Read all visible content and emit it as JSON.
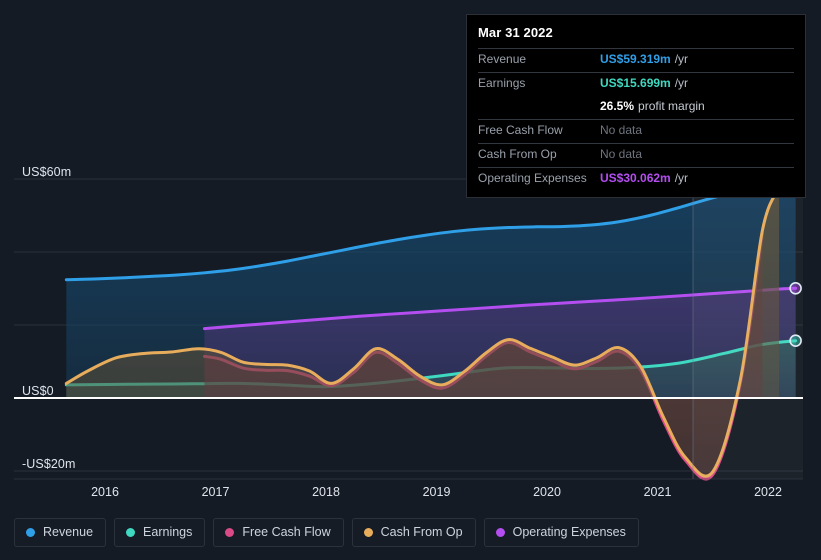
{
  "chart_data": {
    "type": "area",
    "title": "",
    "xlabel": "",
    "ylabel": "",
    "currency": "US$",
    "ylim": [
      -25,
      65
    ],
    "yticks": [
      60,
      0,
      -20
    ],
    "ytick_labels": [
      "US$60m",
      "US$0",
      "-US$20m"
    ],
    "gridlines": [
      60,
      40,
      20,
      0,
      -20
    ],
    "xlim": [
      2015.55,
      2022.35
    ],
    "xticks": [
      2016,
      2017,
      2018,
      2019,
      2020,
      2021,
      2022
    ],
    "xtick_labels": [
      "2016",
      "2017",
      "2018",
      "2019",
      "2020",
      "2021",
      "2022"
    ],
    "grid": true,
    "legend_position": "bottom",
    "zero_line": true,
    "series": [
      {
        "name": "Revenue",
        "color": "#2f9fe8",
        "fill": "#16476b",
        "end_value": 59.319,
        "x": [
          2015.65,
          2015.9,
          2016.15,
          2016.4,
          2016.65,
          2016.9,
          2017.15,
          2017.4,
          2017.65,
          2017.9,
          2018.15,
          2018.4,
          2018.65,
          2018.9,
          2019.15,
          2019.4,
          2019.65,
          2019.9,
          2020.15,
          2020.4,
          2020.65,
          2020.9,
          2021.15,
          2021.4,
          2021.65,
          2021.9,
          2022.08,
          2022.25
        ],
        "values": [
          32.4,
          32.6,
          32.9,
          33.3,
          33.7,
          34.3,
          35.1,
          36.2,
          37.5,
          39.0,
          40.5,
          42.0,
          43.4,
          44.6,
          45.6,
          46.3,
          46.7,
          46.9,
          47.0,
          47.4,
          48.3,
          49.8,
          51.8,
          54.0,
          56.0,
          57.6,
          58.7,
          59.319
        ]
      },
      {
        "name": "Earnings",
        "color": "#3fd8c0",
        "fill": "#2f5b5b",
        "end_value": 15.699,
        "x": [
          2015.65,
          2016.0,
          2016.4,
          2016.8,
          2017.2,
          2017.6,
          2018.0,
          2018.4,
          2018.8,
          2019.2,
          2019.6,
          2020.0,
          2020.4,
          2020.8,
          2021.2,
          2021.6,
          2021.9,
          2022.08,
          2022.25
        ],
        "values": [
          3.6,
          3.7,
          3.8,
          3.9,
          4.0,
          3.6,
          3.1,
          3.9,
          5.2,
          6.7,
          8.2,
          8.3,
          8.1,
          8.4,
          9.6,
          12.2,
          14.4,
          15.2,
          15.699
        ]
      },
      {
        "name": "Free Cash Flow",
        "color": "#d94a86",
        "fill": "#5a2340",
        "end_value": null,
        "start_x": 2016.9,
        "x": [
          2016.9,
          2017.05,
          2017.25,
          2017.45,
          2017.65,
          2017.85,
          2018.05,
          2018.25,
          2018.45,
          2018.65,
          2018.85,
          2019.05,
          2019.25,
          2019.45,
          2019.65,
          2019.85,
          2020.05,
          2020.25,
          2020.45,
          2020.65,
          2020.85,
          2021.05,
          2021.25,
          2021.5,
          2021.75,
          2021.95
        ],
        "values": [
          11.4,
          10.6,
          8.2,
          7.6,
          7.5,
          6.0,
          3.4,
          7.0,
          12.5,
          9.5,
          5.0,
          2.7,
          6.3,
          11.5,
          15.2,
          12.6,
          10.2,
          8.0,
          10.0,
          12.8,
          7.5,
          -6.0,
          -17.0,
          -21.0,
          4.0,
          45.0
        ]
      },
      {
        "name": "Cash From Op",
        "color": "#e8ad5c",
        "fill": "#5e5038",
        "end_value": null,
        "start_x": 2015.65,
        "x": [
          2015.65,
          2015.85,
          2016.1,
          2016.35,
          2016.6,
          2016.85,
          2017.05,
          2017.25,
          2017.45,
          2017.65,
          2017.85,
          2018.05,
          2018.25,
          2018.45,
          2018.65,
          2018.85,
          2019.05,
          2019.25,
          2019.45,
          2019.65,
          2019.85,
          2020.05,
          2020.25,
          2020.45,
          2020.65,
          2020.85,
          2021.05,
          2021.25,
          2021.5,
          2021.75,
          2021.95,
          2022.1
        ],
        "values": [
          4.0,
          7.5,
          11.0,
          12.2,
          12.6,
          13.5,
          12.5,
          9.8,
          9.2,
          9.0,
          7.4,
          4.0,
          8.0,
          13.5,
          10.6,
          6.0,
          3.6,
          7.2,
          12.4,
          16.0,
          13.6,
          11.2,
          9.0,
          11.0,
          13.8,
          8.5,
          -5.0,
          -16.2,
          -20.2,
          5.0,
          46.0,
          57.5
        ]
      },
      {
        "name": "Operating Expenses",
        "color": "#b44ef0",
        "fill": "#473570",
        "end_value": 30.062,
        "start_x": 2016.9,
        "x": [
          2016.9,
          2017.3,
          2017.8,
          2018.3,
          2018.8,
          2019.3,
          2019.8,
          2020.3,
          2020.8,
          2021.3,
          2021.8,
          2022.08,
          2022.25
        ],
        "values": [
          19.0,
          20.0,
          21.2,
          22.4,
          23.4,
          24.4,
          25.4,
          26.3,
          27.2,
          28.2,
          29.2,
          29.8,
          30.062
        ]
      }
    ]
  },
  "tooltip": {
    "title": "Mar 31 2022",
    "rows": [
      {
        "label": "Revenue",
        "value": "US$59.319m",
        "unit": "/yr",
        "color": "#2f9fe8",
        "no_data": false
      },
      {
        "label": "Earnings",
        "value": "US$15.699m",
        "unit": "/yr",
        "color": "#3fd8c0",
        "no_data": false
      },
      {
        "label": "",
        "value": "26.5%",
        "unit": "profit margin",
        "color": "#ffffff",
        "no_data": false,
        "is_margin": true
      },
      {
        "label": "Free Cash Flow",
        "value": "No data",
        "unit": "",
        "color": "#6f757e",
        "no_data": true
      },
      {
        "label": "Cash From Op",
        "value": "No data",
        "unit": "",
        "color": "#6f757e",
        "no_data": true
      },
      {
        "label": "Operating Expenses",
        "value": "US$30.062m",
        "unit": "/yr",
        "color": "#b44ef0",
        "no_data": false
      }
    ]
  },
  "legend": {
    "items": [
      {
        "label": "Revenue",
        "color": "#2f9fe8"
      },
      {
        "label": "Earnings",
        "color": "#3fd8c0"
      },
      {
        "label": "Free Cash Flow",
        "color": "#d94a86"
      },
      {
        "label": "Cash From Op",
        "color": "#e8ad5c"
      },
      {
        "label": "Operating Expenses",
        "color": "#b44ef0"
      }
    ]
  },
  "axes": {
    "y_labels": [
      {
        "text": "US$60m",
        "value": 60
      },
      {
        "text": "US$0",
        "value": 0
      },
      {
        "text": "-US$20m",
        "value": -20
      }
    ],
    "x_labels": [
      "2016",
      "2017",
      "2018",
      "2019",
      "2020",
      "2021",
      "2022"
    ]
  },
  "colors": {
    "background": "#151b24",
    "grid": "#3a414c",
    "zero_line": "#ffffff",
    "tooltip_bg": "#000000"
  }
}
